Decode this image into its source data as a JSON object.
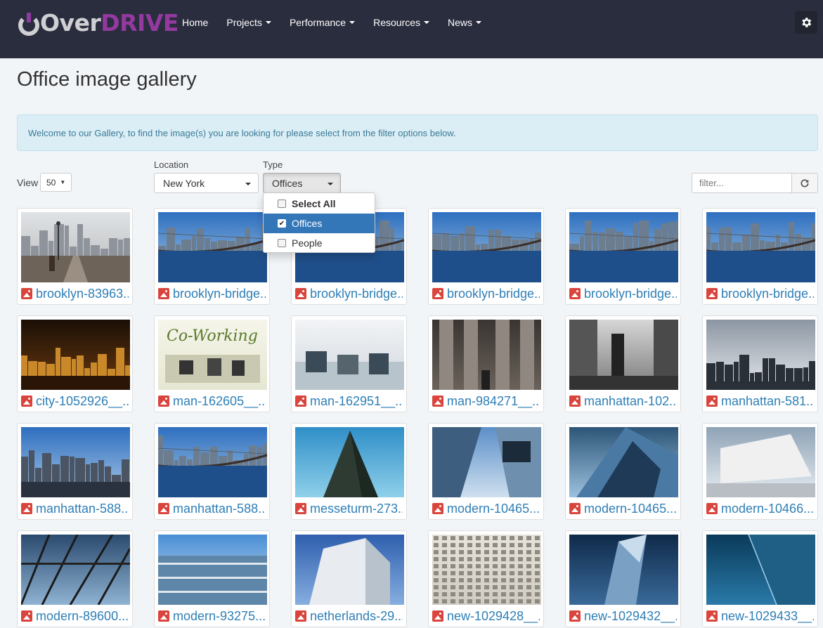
{
  "brand": {
    "part1": "Over",
    "part2": "DRIVE"
  },
  "nav": {
    "items": [
      {
        "label": "Home",
        "dropdown": false
      },
      {
        "label": "Projects",
        "dropdown": true
      },
      {
        "label": "Performance",
        "dropdown": true
      },
      {
        "label": "Resources",
        "dropdown": true
      },
      {
        "label": "News",
        "dropdown": true
      }
    ],
    "settings_icon": "gear-icon"
  },
  "page": {
    "title": "Office image gallery",
    "alert": "Welcome to our Gallery, to find the image(s) you are looking for please select from the filter options below."
  },
  "filters": {
    "view_label": "View",
    "view_value": "50",
    "location_label": "Location",
    "location_value": "New York",
    "type_label": "Type",
    "type_value": "Offices",
    "type_menu": [
      {
        "label": "Select All",
        "checked": false
      },
      {
        "label": "Offices",
        "checked": true
      },
      {
        "label": "People",
        "checked": false
      }
    ],
    "search_placeholder": "filter...",
    "refresh_icon": "refresh-icon"
  },
  "colors": {
    "navbar": "#2a2d3e",
    "brand_purple": "#93399f",
    "link_blue": "#2f7fb6",
    "selected_blue": "#3477b8",
    "alert_bg": "#dbeef6"
  },
  "gallery": [
    {
      "name": "brooklyn-83963..."
    },
    {
      "name": "brooklyn-bridge..."
    },
    {
      "name": "brooklyn-bridge..."
    },
    {
      "name": "brooklyn-bridge..."
    },
    {
      "name": "brooklyn-bridge..."
    },
    {
      "name": "brooklyn-bridge..."
    },
    {
      "name": "city-1052926__..."
    },
    {
      "name": "man-162605__..."
    },
    {
      "name": "man-162951__..."
    },
    {
      "name": "man-984271__..."
    },
    {
      "name": "manhattan-102..."
    },
    {
      "name": "manhattan-581..."
    },
    {
      "name": "manhattan-588..."
    },
    {
      "name": "manhattan-588..."
    },
    {
      "name": "messeturm-273..."
    },
    {
      "name": "modern-10465..."
    },
    {
      "name": "modern-10465..."
    },
    {
      "name": "modern-10466..."
    },
    {
      "name": "modern-89600..."
    },
    {
      "name": "modern-93275..."
    },
    {
      "name": "netherlands-29..."
    },
    {
      "name": "new-1029428__..."
    },
    {
      "name": "new-1029432__..."
    },
    {
      "name": "new-1029433__..."
    }
  ]
}
